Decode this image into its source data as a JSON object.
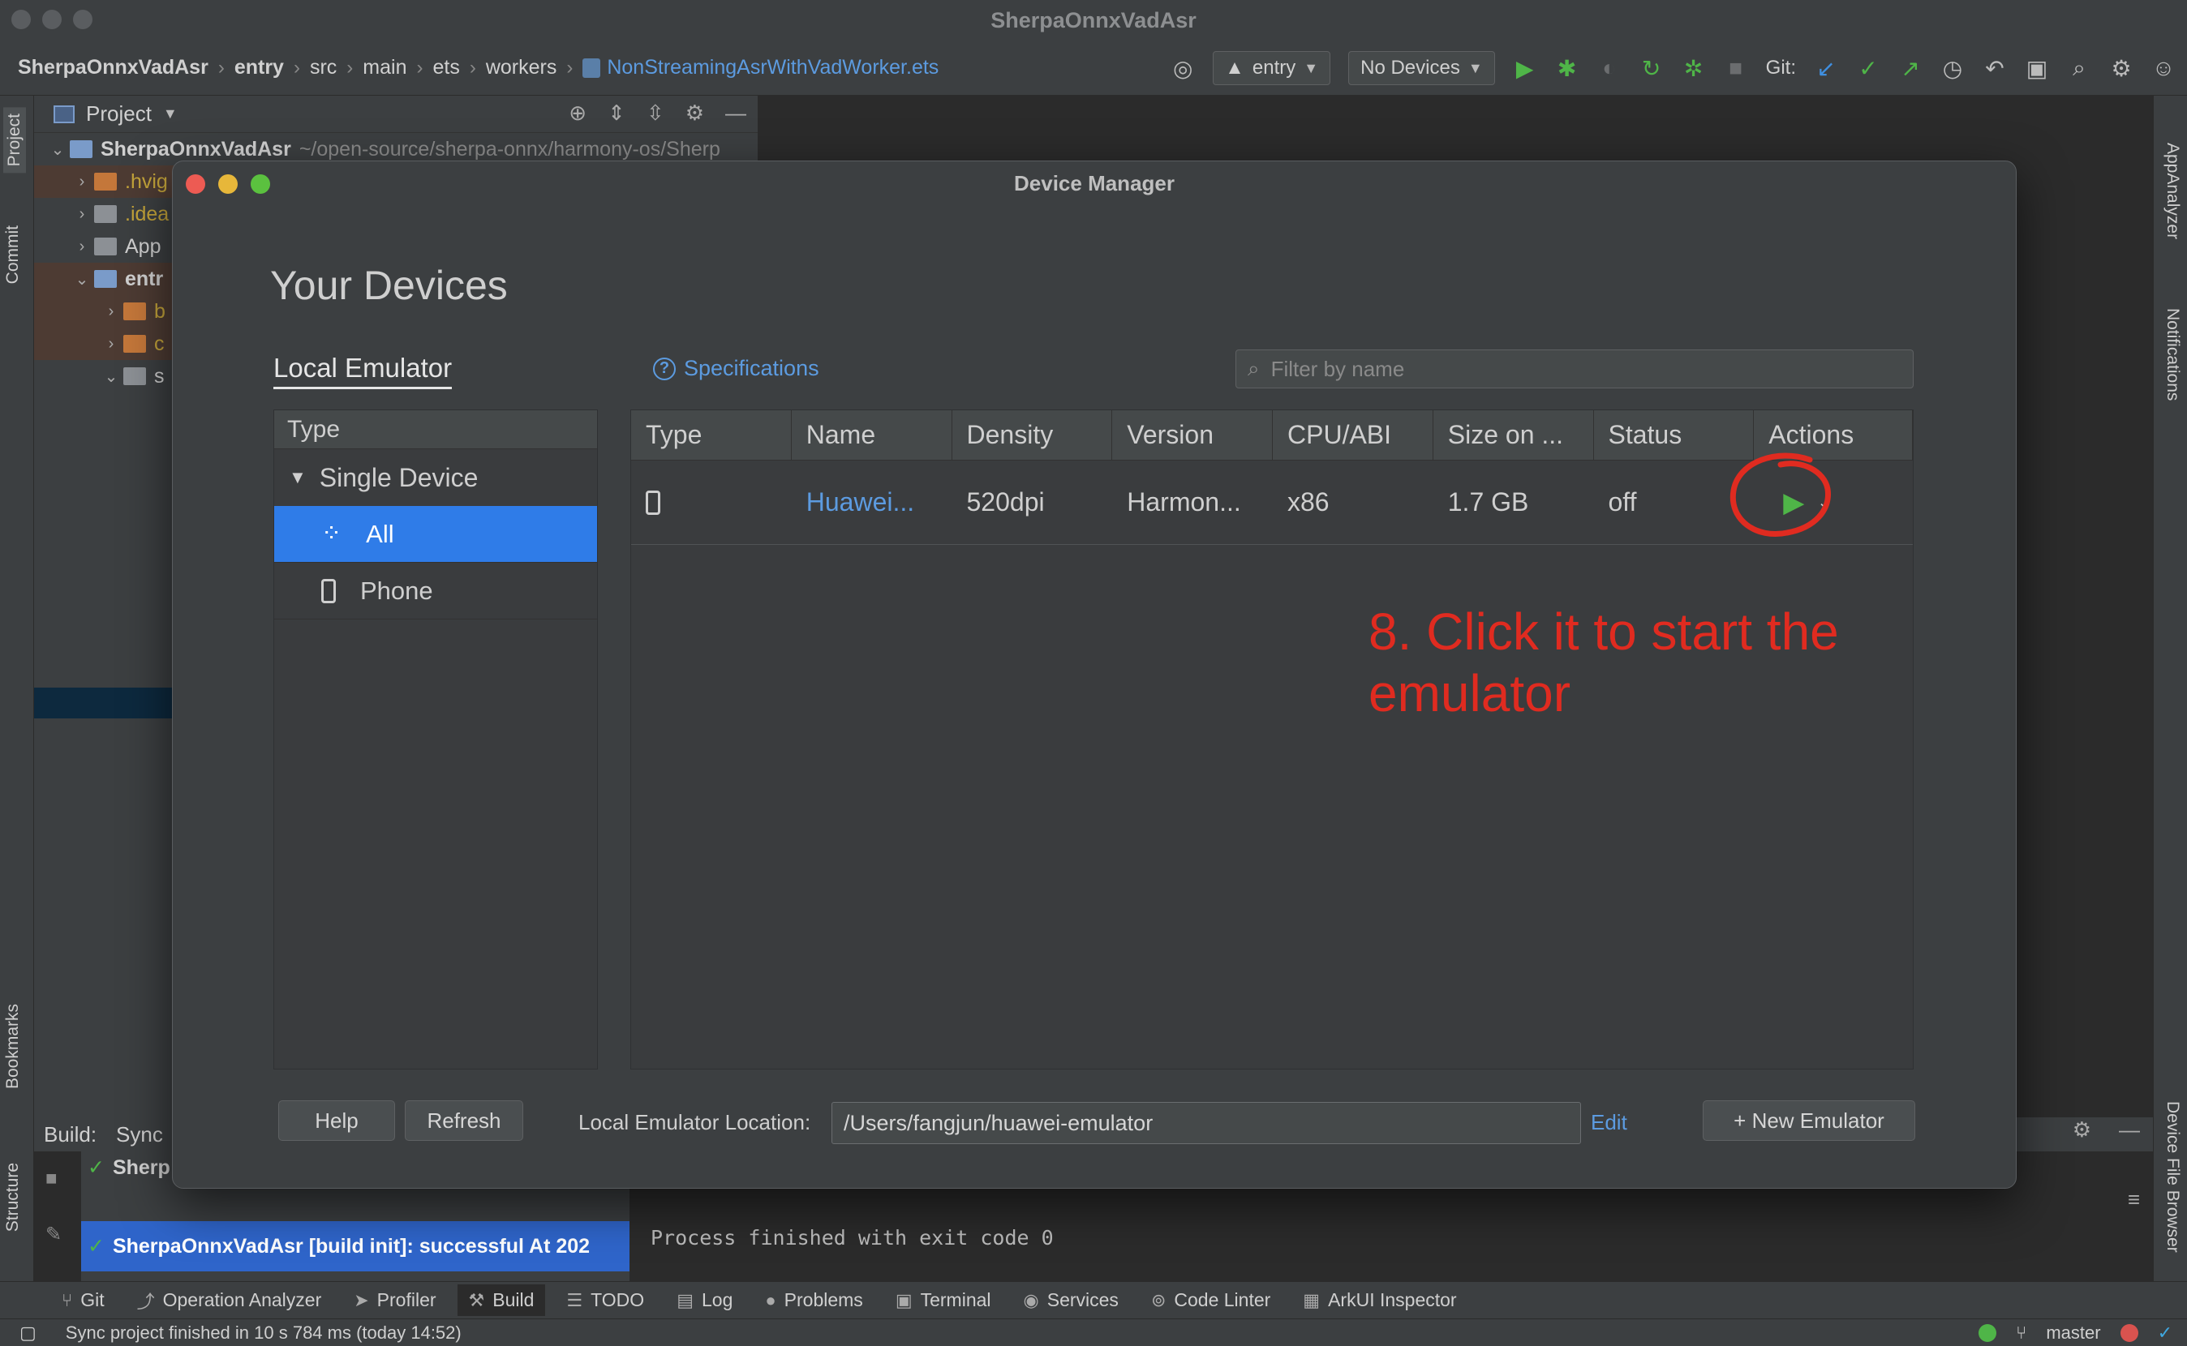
{
  "window": {
    "title": "SherpaOnnxVadAsr"
  },
  "breadcrumbs": [
    "SherpaOnnxVadAsr",
    "entry",
    "src",
    "main",
    "ets",
    "workers"
  ],
  "breadcrumb_file": "NonStreamingAsrWithVadWorker.ets",
  "toolbar": {
    "module_select": "entry",
    "device_select": "No Devices",
    "git_label": "Git:"
  },
  "left_tabs": [
    "Project",
    "Commit",
    "Bookmarks",
    "Structure"
  ],
  "right_tabs": [
    "AppAnalyzer",
    "Notifications",
    "Device File Browser"
  ],
  "project_panel": {
    "title": "Project",
    "root_name": "SherpaOnnxVadAsr",
    "root_path": "~/open-source/sherpa-onnx/harmony-os/Sherp",
    "items": [
      ".hvig",
      ".idea",
      "App",
      "entr",
      "b",
      "c",
      "s"
    ]
  },
  "build": {
    "label": "Build:",
    "tab": "Sync",
    "tree_top": "Sherp",
    "tree_selected": "SherpaOnnxVadAsr [build init]: successful At 202",
    "console": "Process finished with exit code 0"
  },
  "bottom_tabs": [
    {
      "label": "Git",
      "icon": "git-icon"
    },
    {
      "label": "Operation Analyzer",
      "icon": "chart-icon"
    },
    {
      "label": "Profiler",
      "icon": "profiler-icon"
    },
    {
      "label": "Build",
      "icon": "hammer-icon"
    },
    {
      "label": "TODO",
      "icon": "list-icon"
    },
    {
      "label": "Log",
      "icon": "log-icon"
    },
    {
      "label": "Problems",
      "icon": "warning-icon"
    },
    {
      "label": "Terminal",
      "icon": "terminal-icon"
    },
    {
      "label": "Services",
      "icon": "services-icon"
    },
    {
      "label": "Code Linter",
      "icon": "linter-icon"
    },
    {
      "label": "ArkUI Inspector",
      "icon": "inspector-icon"
    }
  ],
  "status": {
    "message": "Sync project finished in 10 s 784 ms (today 14:52)",
    "branch": "master"
  },
  "dialog": {
    "title": "Device Manager",
    "heading": "Your Devices",
    "tab_local": "Local Emulator",
    "specifications": "Specifications",
    "filter_placeholder": "Filter by name",
    "type_header": "Type",
    "type_group": "Single Device",
    "type_items": [
      "All",
      "Phone"
    ],
    "columns": [
      "Type",
      "Name",
      "Density",
      "Version",
      "CPU/ABI",
      "Size on ...",
      "Status",
      "Actions"
    ],
    "devices": [
      {
        "name": "Huawei...",
        "density": "520dpi",
        "version": "Harmon...",
        "cpu": "x86",
        "size": "1.7 GB",
        "status": "off"
      }
    ],
    "annotation": "8. Click it to start the emulator",
    "help_button": "Help",
    "refresh_button": "Refresh",
    "location_label": "Local Emulator Location:",
    "location_value": "/Users/fangjun/huawei-emulator",
    "edit_link": "Edit",
    "new_emulator_button": "+ New Emulator"
  },
  "colors": {
    "accent": "#2f7ce8",
    "link": "#5c9be0",
    "annotation": "#e02b20",
    "run_green": "#4fb548"
  }
}
